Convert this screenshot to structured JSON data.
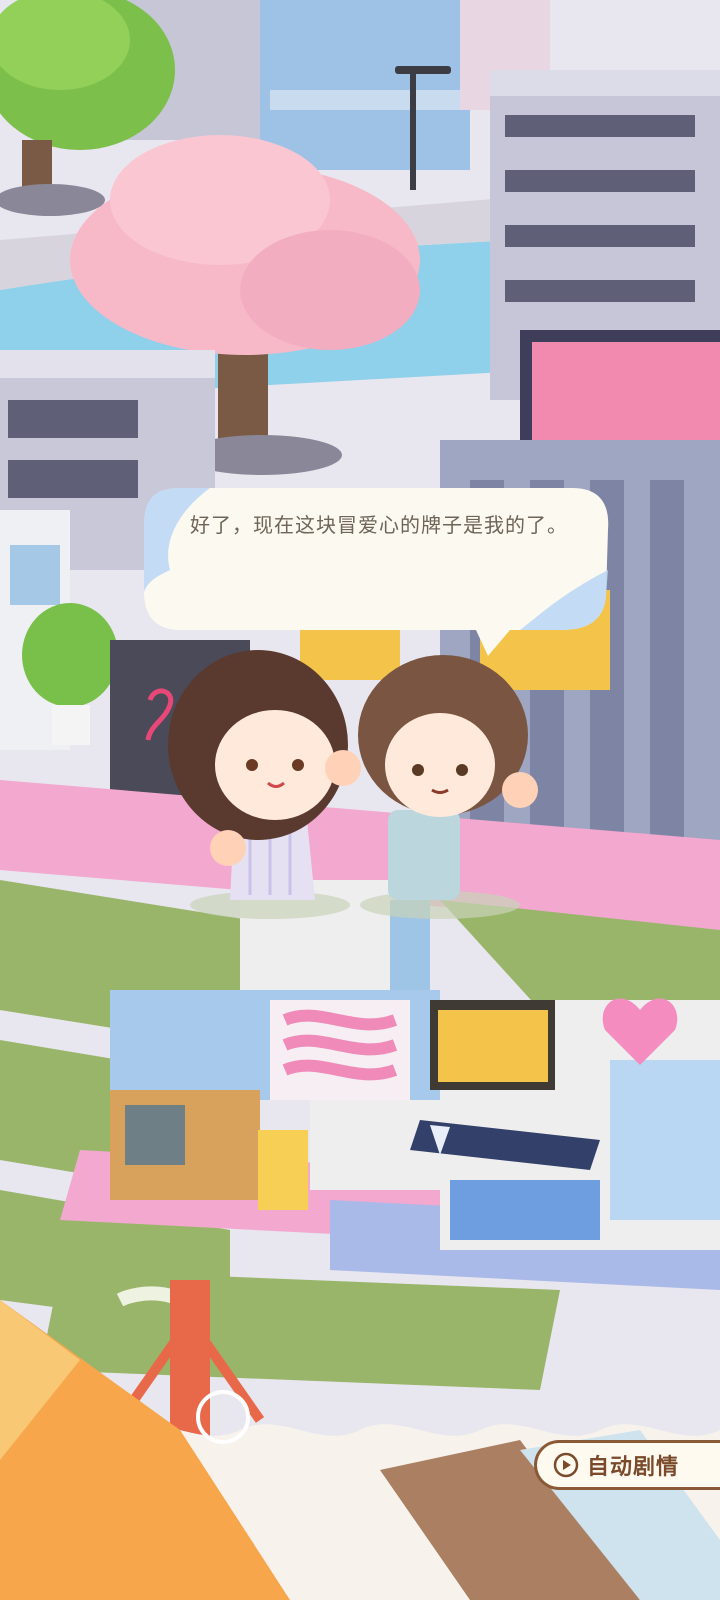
{
  "dialogue": {
    "text": "好了，现在这块冒爱心的牌子是我的了。"
  },
  "controls": {
    "auto_story_label": "自动剧情"
  },
  "icons": {
    "auto_play": "play-circle-icon",
    "skip": "circle-icon"
  },
  "colors": {
    "bubble_bg": "#fbf9f0",
    "bubble_accent": "#b8d6f5",
    "button_border": "#8a5a38",
    "button_text": "#7a4a2b"
  }
}
